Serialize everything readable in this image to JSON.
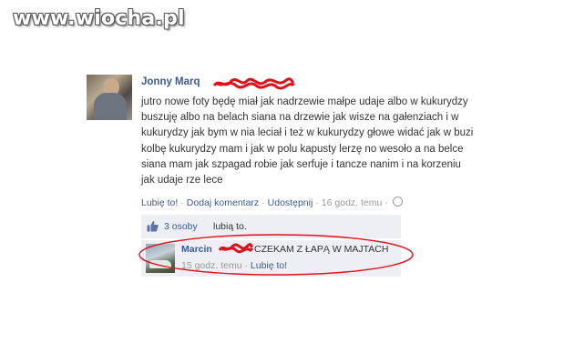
{
  "watermark": {
    "text": "www.wiocha.pl"
  },
  "post": {
    "author": "Jonny Marq",
    "text_lines": [
      "jutro nowe foty będę miał jak nadrzewie małpe udaje albo w kukurydzy",
      "buszuję albo na belach siana na drzewie jak wisze na gałenziach i w",
      "kukurydzy jak bym w nia leciał i też w kukurydzy głowe widać jak w buzi",
      "kolbę kukurydzy mam i jak w polu kapusty lerzę no wesoło a na belce",
      "siana mam jak szpagad robie jak serfuje i tancze nanim i na korzeniu",
      "jak udaje rze lece"
    ],
    "actions": {
      "like": "Lubię to!",
      "comment": "Dodaj komentarz",
      "share": "Udostępnij",
      "time": "16 godz. temu",
      "separator": "·"
    }
  },
  "likes": {
    "count": "3 osoby",
    "rest": "lubią to."
  },
  "comment": {
    "author": "Marcin",
    "text": "CZEKAM Z ŁAPĄ W MAJTACH",
    "time": "15 godz. temu",
    "separator": "·",
    "like": "Lubię to!"
  },
  "colors": {
    "link": "#3b5998",
    "meta": "#999999",
    "box_bg": "#edeff4",
    "scribble": "#e0101a",
    "ellipse": "#e0101a"
  }
}
